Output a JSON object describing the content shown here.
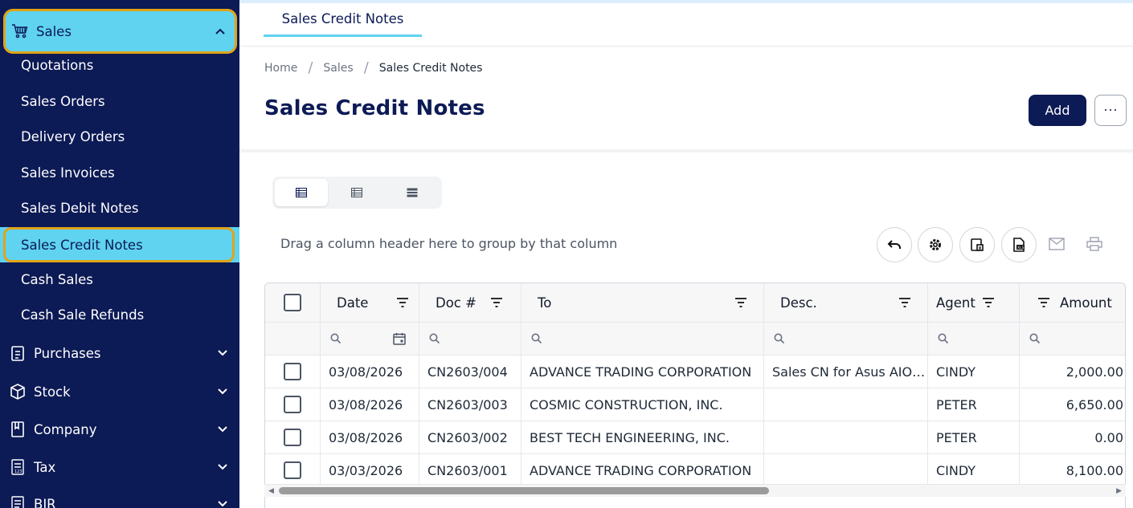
{
  "sidebar": {
    "sales": {
      "label": "Sales"
    },
    "sales_items": [
      "Quotations",
      "Sales Orders",
      "Delivery Orders",
      "Sales Invoices",
      "Sales Debit Notes",
      "Sales Credit Notes",
      "Cash Sales",
      "Cash Sale Refunds"
    ],
    "active_item": "Sales Credit Notes",
    "groups": [
      {
        "label": "Purchases",
        "icon": "clipboard-icon"
      },
      {
        "label": "Stock",
        "icon": "box-icon"
      },
      {
        "label": "Company",
        "icon": "book-icon"
      },
      {
        "label": "Tax",
        "icon": "tax-icon"
      },
      {
        "label": "BIR",
        "icon": "document-icon"
      }
    ]
  },
  "tabs": {
    "active": "Sales Credit Notes"
  },
  "breadcrumb": {
    "home": "Home",
    "section": "Sales",
    "current": "Sales Credit Notes"
  },
  "page": {
    "title": "Sales Credit Notes",
    "add_label": "Add",
    "more_label": "⋯"
  },
  "grid": {
    "group_hint": "Drag a column header here to group by that column",
    "columns": {
      "date": "Date",
      "doc": "Doc #",
      "to": "To",
      "desc": "Desc.",
      "agent": "Agent",
      "amount": "Amount"
    },
    "rows": [
      {
        "date": "03/08/2026",
        "doc": "CN2603/004",
        "to": "ADVANCE TRADING CORPORATION",
        "desc": "Sales CN for Asus AIO…",
        "agent": "CINDY",
        "amount": "2,000.00"
      },
      {
        "date": "03/08/2026",
        "doc": "CN2603/003",
        "to": "COSMIC CONSTRUCTION, INC.",
        "desc": "",
        "agent": "PETER",
        "amount": "6,650.00"
      },
      {
        "date": "03/08/2026",
        "doc": "CN2603/002",
        "to": "BEST TECH ENGINEERING, INC.",
        "desc": "",
        "agent": "PETER",
        "amount": "0.00"
      },
      {
        "date": "03/03/2026",
        "doc": "CN2603/001",
        "to": "ADVANCE TRADING CORPORATION",
        "desc": "",
        "agent": "CINDY",
        "amount": "8,100.00"
      }
    ]
  },
  "colors": {
    "navy": "#0c1a55",
    "accent": "#5fd3f0",
    "highlight": "#e0a418",
    "link": "#1eaee0"
  }
}
